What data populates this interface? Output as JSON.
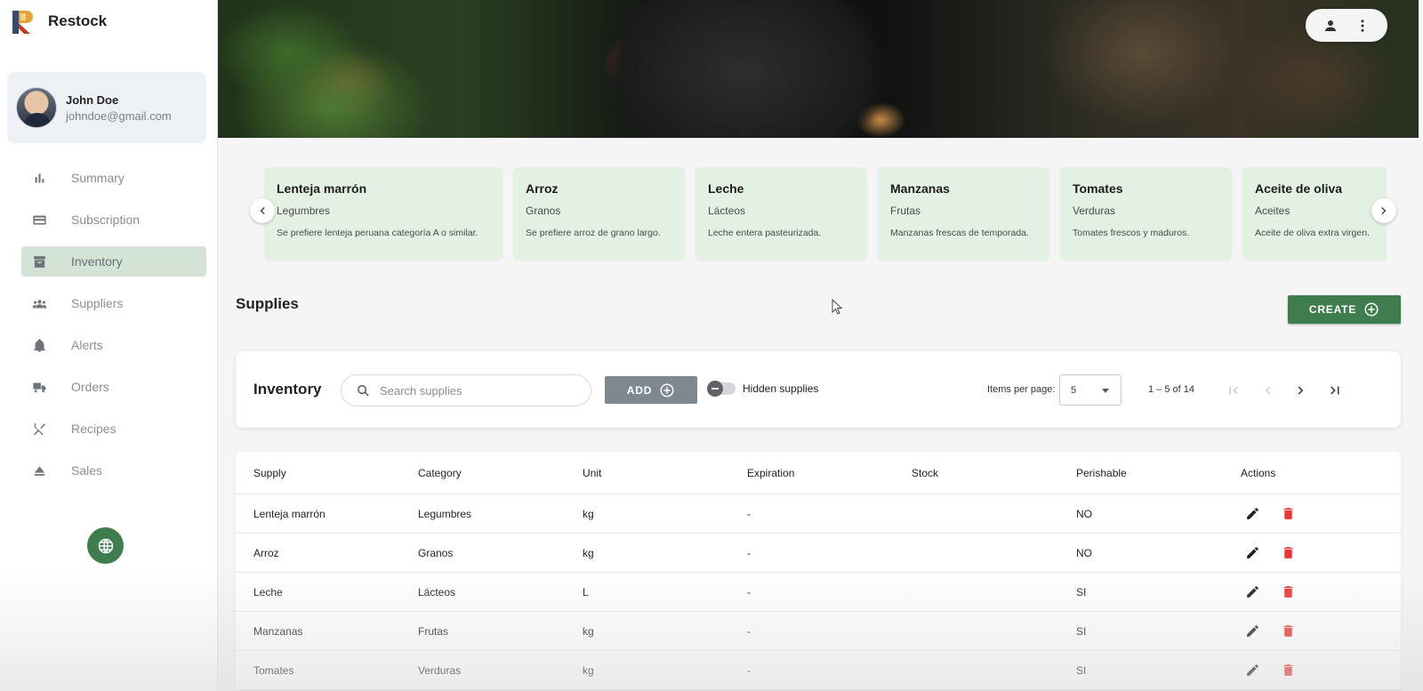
{
  "app": {
    "name": "Restock"
  },
  "user": {
    "name": "John Doe",
    "email": "johndoe@gmail.com"
  },
  "nav": [
    {
      "label": "Summary",
      "icon": "bar-chart-icon",
      "active": false
    },
    {
      "label": "Subscription",
      "icon": "credit-card-icon",
      "active": false
    },
    {
      "label": "Inventory",
      "icon": "archive-box-icon",
      "active": true
    },
    {
      "label": "Suppliers",
      "icon": "group-icon",
      "active": false
    },
    {
      "label": "Alerts",
      "icon": "bell-icon",
      "active": false
    },
    {
      "label": "Orders",
      "icon": "truck-icon",
      "active": false
    },
    {
      "label": "Recipes",
      "icon": "utensils-icon",
      "active": false
    },
    {
      "label": "Sales",
      "icon": "eject-icon",
      "active": false
    }
  ],
  "cards": [
    {
      "title": "Lenteja marrón",
      "category": "Legumbres",
      "description": "Se prefiere lenteja peruana categoría A o similar."
    },
    {
      "title": "Arroz",
      "category": "Granos",
      "description": "Se prefiere arroz de grano largo."
    },
    {
      "title": "Leche",
      "category": "Lácteos",
      "description": "Leche entera pasteurizada."
    },
    {
      "title": "Manzanas",
      "category": "Frutas",
      "description": "Manzanas frescas de temporada."
    },
    {
      "title": "Tomates",
      "category": "Verduras",
      "description": "Tomates frescos y maduros."
    },
    {
      "title": "Aceite de oliva",
      "category": "Aceites",
      "description": "Aceite de oliva extra virgen."
    }
  ],
  "supplies": {
    "title": "Supplies",
    "create_label": "CREATE"
  },
  "toolbar": {
    "title": "Inventory",
    "search_placeholder": "Search supplies",
    "add_label": "ADD",
    "hidden_label": "Hidden supplies",
    "items_per_page_label": "Items per page:",
    "items_per_page_value": "5",
    "range": "1 – 5 of 14"
  },
  "table": {
    "headers": [
      "Supply",
      "Category",
      "Unit",
      "Expiration",
      "Stock",
      "Perishable",
      "Actions"
    ],
    "rows": [
      [
        "Lenteja marrón",
        "Legumbres",
        "kg",
        "-",
        "",
        "NO"
      ],
      [
        "Arroz",
        "Granos",
        "kg",
        "-",
        "",
        "NO"
      ],
      [
        "Leche",
        "Lácteos",
        "L",
        "-",
        "",
        "SI"
      ],
      [
        "Manzanas",
        "Frutas",
        "kg",
        "-",
        "",
        "SI"
      ],
      [
        "Tomates",
        "Verduras",
        "kg",
        "-",
        "",
        "SI"
      ]
    ]
  },
  "colors": {
    "brand_green": "#3f7d4f",
    "active_nav": "#d3e3d5",
    "card_bg": "#e3f1e3",
    "delete_red": "#e53935",
    "add_gray": "#7e8891"
  }
}
